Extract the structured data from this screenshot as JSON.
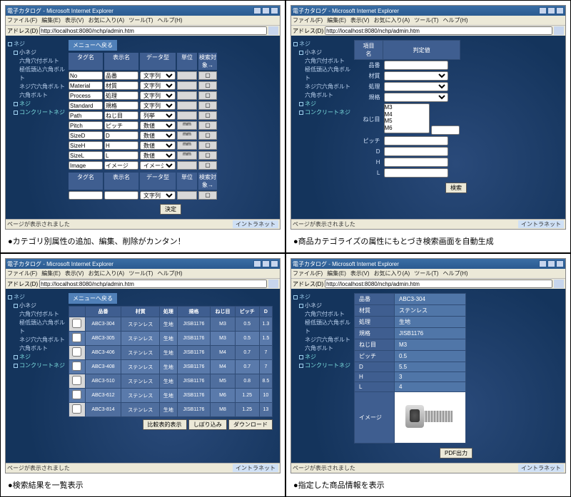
{
  "browser": {
    "title": "電子カタログ - Microsoft Internet Explorer",
    "menus": [
      "ファイル(F)",
      "編集(E)",
      "表示(V)",
      "お気に入り(A)",
      "ツール(T)",
      "ヘルプ(H)"
    ],
    "addr_label": "アドレス(D)",
    "url": "http://localhost:8080/nchp/admin.htm",
    "status": "ページが表示されました",
    "netzone": "イントラネット"
  },
  "tree": {
    "root": "ネジ",
    "items": [
      {
        "t": "小ネジ",
        "lvl": 2
      },
      {
        "t": "六角穴付ボルト",
        "lvl": 3
      },
      {
        "t": "極低頭込六角ボルト",
        "lvl": 3
      },
      {
        "t": "ネジ穴六角ボルト",
        "lvl": 3
      },
      {
        "t": "六角ボルト",
        "lvl": 3
      },
      {
        "t": "ネジ",
        "lvl": 2,
        "cy": true
      },
      {
        "t": "コンクリートネジ",
        "lvl": 2,
        "cy": true
      }
    ]
  },
  "panel1": {
    "menu_back": "メニューへ戻る",
    "headers": [
      "タグ名",
      "表示名",
      "データ型",
      "単位",
      "検索対象→"
    ],
    "rows": [
      {
        "tag": "No",
        "disp": "品番",
        "type": "文字列",
        "unit": ""
      },
      {
        "tag": "Material",
        "disp": "材質",
        "type": "文字列",
        "unit": ""
      },
      {
        "tag": "Process",
        "disp": "処理",
        "type": "文字列",
        "unit": ""
      },
      {
        "tag": "Standard",
        "disp": "規格",
        "type": "文字列",
        "unit": ""
      },
      {
        "tag": "Path",
        "disp": "ねじ目",
        "type": "列挙",
        "unit": ""
      },
      {
        "tag": "Pitch",
        "disp": "ピッチ",
        "type": "数値",
        "unit": "mm"
      },
      {
        "tag": "SizeD",
        "disp": "D",
        "type": "数値",
        "unit": "mm"
      },
      {
        "tag": "SizeH",
        "disp": "H",
        "type": "数値",
        "unit": "mm"
      },
      {
        "tag": "SizeL",
        "disp": "L",
        "type": "数値",
        "unit": "mm"
      },
      {
        "tag": "Image",
        "disp": "イメージ",
        "type": "イメージ",
        "unit": ""
      }
    ],
    "newrow_type": "文字列",
    "submit": "決定"
  },
  "panel2": {
    "col_name": "項目名",
    "col_val": "判定値",
    "rows": [
      {
        "k": "品番",
        "ctl": "text",
        "v": ""
      },
      {
        "k": "材質",
        "ctl": "select",
        "v": ""
      },
      {
        "k": "処理",
        "ctl": "select",
        "v": ""
      },
      {
        "k": "規格",
        "ctl": "select",
        "v": ""
      },
      {
        "k": "ねじ目",
        "ctl": "list",
        "opts": [
          "M3",
          "M4",
          "M5",
          "M6"
        ]
      },
      {
        "k": "ピッチ",
        "ctl": "text",
        "v": ""
      },
      {
        "k": "D",
        "ctl": "text",
        "v": ""
      },
      {
        "k": "H",
        "ctl": "text",
        "v": ""
      },
      {
        "k": "L",
        "ctl": "text",
        "v": ""
      }
    ],
    "search": "検索"
  },
  "panel3": {
    "menu_back": "メニューへ戻る",
    "headers": [
      "",
      "品番",
      "材質",
      "処理",
      "規格",
      "ねじ目",
      "ピッチ",
      "D"
    ],
    "rows": [
      [
        "ABC3-304",
        "ステンレス",
        "生地",
        "JISB1176",
        "M3",
        "0.5",
        "1.3"
      ],
      [
        "ABC3-305",
        "ステンレス",
        "生地",
        "JISB1176",
        "M3",
        "0.5",
        "1.5"
      ],
      [
        "ABC3-406",
        "ステンレス",
        "生地",
        "JISB1176",
        "M4",
        "0.7",
        "7"
      ],
      [
        "ABC3-408",
        "ステンレス",
        "生地",
        "JISB1176",
        "M4",
        "0.7",
        "7"
      ],
      [
        "ABC3-510",
        "ステンレス",
        "生地",
        "JISB1176",
        "M5",
        "0.8",
        "8.5"
      ],
      [
        "ABC3-612",
        "ステンレス",
        "生地",
        "JISB1176",
        "M6",
        "1.25",
        "10"
      ],
      [
        "ABC3-814",
        "ステンレス",
        "生地",
        "JISB1176",
        "M8",
        "1.25",
        "13"
      ]
    ],
    "btns": [
      "比較表的表示",
      "しぼり込み",
      "ダウンロード"
    ]
  },
  "panel4": {
    "rows": [
      {
        "k": "品番",
        "v": "ABC3-304"
      },
      {
        "k": "材質",
        "v": "ステンレス"
      },
      {
        "k": "処理",
        "v": "生地"
      },
      {
        "k": "規格",
        "v": "JISB1176"
      },
      {
        "k": "ねじ目",
        "v": "M3"
      },
      {
        "k": "ピッチ",
        "v": "0.5"
      },
      {
        "k": "D",
        "v": "5.5"
      },
      {
        "k": "H",
        "v": "3"
      },
      {
        "k": "L",
        "v": "4"
      }
    ],
    "image_label": "イメージ",
    "pdf": "PDF出力"
  },
  "captions": {
    "c1": "●カテゴリ別属性の追加、編集、削除がカンタン！",
    "c2": "●商品カテゴライズの属性にもとづき検索画面を自動生成",
    "c3": "●検索結果を一覧表示",
    "c4": "●指定した商品情報を表示"
  }
}
